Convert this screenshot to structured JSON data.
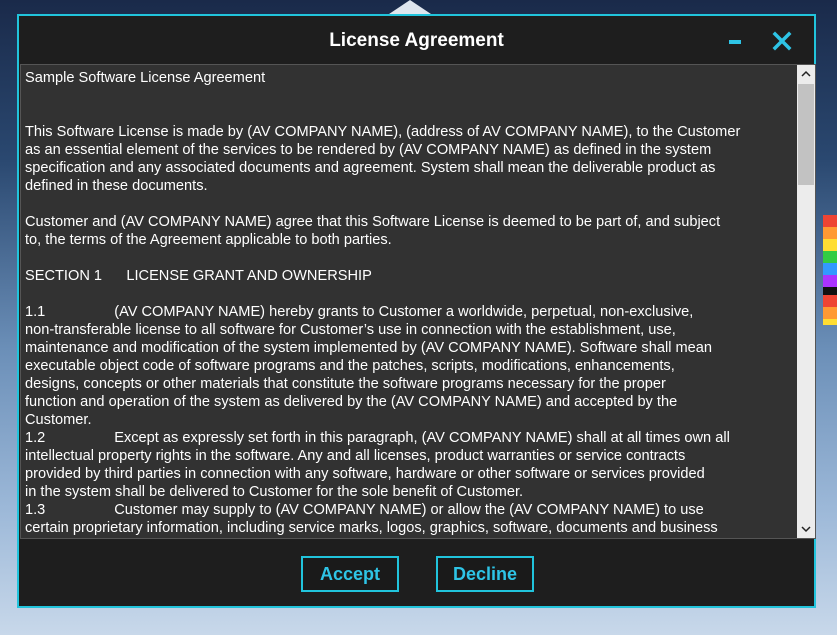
{
  "dialog": {
    "title": "License Agreement",
    "minimize_icon": "minimize-icon",
    "close_icon": "close-icon",
    "accent_color": "#21c4dc"
  },
  "license": {
    "paragraphs": [
      "Sample Software License Agreement",
      "",
      "",
      "This Software License is made by (AV COMPANY NAME), (address of AV COMPANY NAME), to the Customer\nas an essential element of the services to be rendered by (AV COMPANY NAME) as defined in the system\nspecification and any associated documents and agreement. System shall mean the deliverable product as\ndefined in these documents.",
      "",
      "Customer and (AV COMPANY NAME) agree that this Software License is deemed to be part of, and subject\nto, the terms of the Agreement applicable to both parties.",
      "",
      "SECTION 1      LICENSE GRANT AND OWNERSHIP",
      "",
      "1.1                 (AV COMPANY NAME) hereby grants to Customer a worldwide, perpetual, non-exclusive,\nnon-transferable license to all software for Customer’s use in connection with the establishment, use,\nmaintenance and modification of the system implemented by (AV COMPANY NAME). Software shall mean\nexecutable object code of software programs and the patches, scripts, modifications, enhancements,\ndesigns, concepts or other materials that constitute the software programs necessary for the proper\nfunction and operation of the system as delivered by the (AV COMPANY NAME) and accepted by the\nCustomer.",
      "1.2                 Except as expressly set forth in this paragraph, (AV COMPANY NAME) shall at all times own all\nintellectual property rights in the software. Any and all licenses, product warranties or service contracts\nprovided by third parties in connection with any software, hardware or other software or services provided\nin the system shall be delivered to Customer for the sole benefit of Customer.",
      "1.3                 Customer may supply to (AV COMPANY NAME) or allow the (AV COMPANY NAME) to use\ncertain proprietary information, including service marks, logos, graphics, software, documents and business"
    ]
  },
  "scrollbar": {
    "position": 0.0
  },
  "buttons": {
    "accept_label": "Accept",
    "decline_label": "Decline"
  }
}
